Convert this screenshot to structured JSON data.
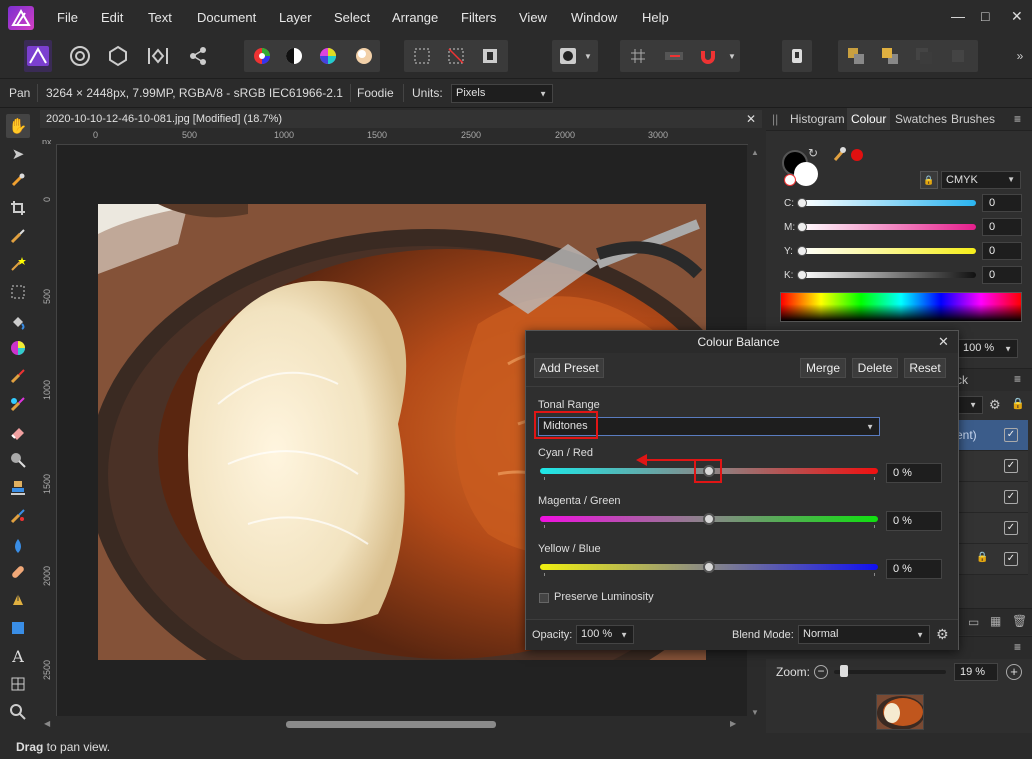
{
  "menu": {
    "items": [
      "File",
      "Edit",
      "Text",
      "Document",
      "Layer",
      "Select",
      "Arrange",
      "Filters",
      "View",
      "Window",
      "Help"
    ]
  },
  "window_controls": {
    "minimize": "—",
    "maximize": "□",
    "close": "✕"
  },
  "context_bar": {
    "tool": "Pan",
    "doc_info": "3264 × 2448px, 7.99MP, RGBA/8 - sRGB IEC61966-2.1",
    "profile": "Foodie",
    "units_label": "Units:",
    "units_value": "Pixels"
  },
  "document": {
    "tab_title": "2020-10-10-12-46-10-081.jpg [Modified] (18.7%)",
    "close": "✕"
  },
  "ruler_h": {
    "unit": "px",
    "labels": [
      "0",
      "500",
      "1000",
      "1500",
      "2000",
      "2500",
      "3000"
    ]
  },
  "ruler_v": {
    "labels": [
      "0",
      "500",
      "1000",
      "1500",
      "2000",
      "2500"
    ]
  },
  "status": {
    "bold": "Drag",
    "rest": " to pan view."
  },
  "right_panel": {
    "tabs": [
      "Histogram",
      "Colour",
      "Swatches",
      "Brushes"
    ],
    "active_tab": "Colour",
    "colour_model": "CMYK",
    "channels": [
      {
        "label": "C:",
        "value": "0"
      },
      {
        "label": "M:",
        "value": "0"
      },
      {
        "label": "Y:",
        "value": "0"
      },
      {
        "label": "K:",
        "value": "0"
      }
    ],
    "opacity_value": "100 %",
    "layers_partial_label": "ck",
    "layer_partial_name": "ent)",
    "navigator": {
      "zoom_label": "Zoom:",
      "zoom_value": "19 %",
      "zoom_fraction": 0.19
    }
  },
  "dialog": {
    "title": "Colour Balance",
    "close": "✕",
    "buttons": {
      "add_preset": "Add Preset",
      "merge": "Merge",
      "delete": "Delete",
      "reset": "Reset"
    },
    "tonal_range": {
      "label": "Tonal Range",
      "value": "Midtones"
    },
    "sliders": [
      {
        "label": "Cyan / Red",
        "value": "0 %",
        "position": 0.5
      },
      {
        "label": "Magenta / Green",
        "value": "0 %",
        "position": 0.5
      },
      {
        "label": "Yellow / Blue",
        "value": "0 %",
        "position": 0.5
      }
    ],
    "preserve_luminosity": {
      "label": "Preserve Luminosity",
      "checked": false
    },
    "footer": {
      "opacity_label": "Opacity:",
      "opacity_value": "100 %",
      "blend_label": "Blend Mode:",
      "blend_value": "Normal"
    }
  },
  "colors": {
    "accent": "#6e3fd9",
    "annotation": "#e01515",
    "panel_bg": "#2f2f2f"
  }
}
